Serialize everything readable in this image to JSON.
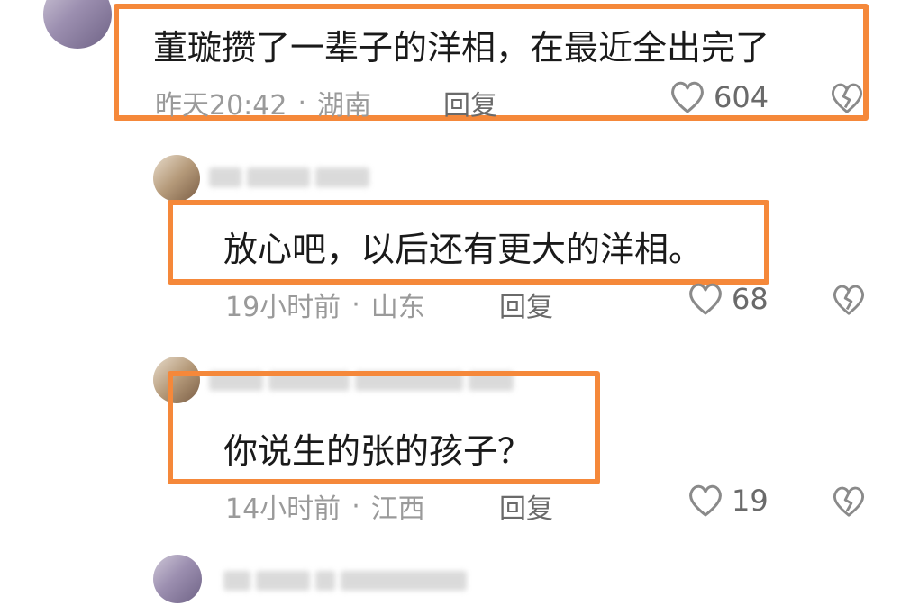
{
  "comments": [
    {
      "text": "董璇攒了一辈子的洋相，在最近全出完了",
      "time": "昨天20:42",
      "location": "湖南",
      "reply_label": "回复",
      "likes": "604"
    },
    {
      "text": "放心吧，以后还有更大的洋相。",
      "time": "19小时前",
      "location": "山东",
      "reply_label": "回复",
      "likes": "68"
    },
    {
      "text": "你说生的张的孩子？",
      "time": "14小时前",
      "location": "江西",
      "reply_label": "回复",
      "likes": "19"
    }
  ],
  "meta_separator": "·",
  "icons": {
    "like": "heart-outline-icon",
    "dislike": "broken-heart-icon"
  },
  "colors": {
    "highlight_border": "#f5883a",
    "meta_text": "#9a9a9a"
  }
}
